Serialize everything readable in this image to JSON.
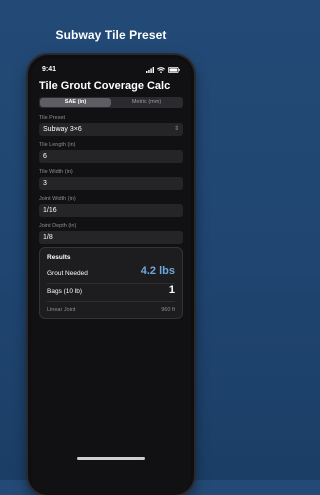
{
  "page": {
    "heading": "Subway Tile Preset"
  },
  "status_bar": {
    "time": "9:41",
    "icons": [
      "signal-icon",
      "wifi-icon",
      "battery-icon"
    ]
  },
  "app": {
    "title": "Tile Grout Coverage Calc",
    "units": {
      "options": [
        "SAE (in)",
        "Metric (mm)"
      ],
      "selected": "SAE (in)"
    },
    "fields": {
      "preset": {
        "label": "Tile Preset",
        "value": "Subway 3×6"
      },
      "tile_length": {
        "label": "Tile Length (in)",
        "value": "6"
      },
      "tile_width": {
        "label": "Tile Width (in)",
        "value": "3"
      },
      "joint_width": {
        "label": "Joint Width (in)",
        "value": "1/16"
      },
      "joint_depth": {
        "label": "Joint Depth (in)",
        "value": "1/8"
      }
    },
    "results": {
      "title": "Results",
      "grout_needed": {
        "label": "Grout Needed",
        "value": "4.2 lbs"
      },
      "bags": {
        "label": "Bags (10 lb)",
        "value": "1"
      },
      "linear_joint": {
        "label": "Linear Joint",
        "value": "960 ft"
      }
    }
  },
  "colors": {
    "accent_blue": "#6fa8dc",
    "background": "#1f4570"
  }
}
